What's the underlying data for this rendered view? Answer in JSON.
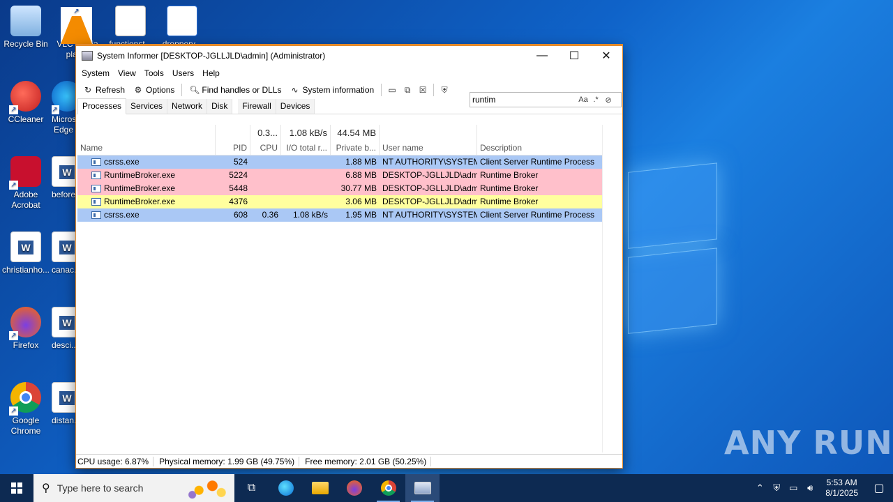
{
  "desktop": {
    "icons": [
      {
        "label": "Recycle Bin"
      },
      {
        "label": "VLC media player"
      },
      {
        "label": "functionst..."
      },
      {
        "label": "dropperv..."
      },
      {
        "label": "CCleaner"
      },
      {
        "label": "Microsoft Edge"
      },
      {
        "label": "Adobe Acrobat"
      },
      {
        "label": "before..."
      },
      {
        "label": "christianho..."
      },
      {
        "label": "canac..."
      },
      {
        "label": "Firefox"
      },
      {
        "label": "desci..."
      },
      {
        "label": "Google Chrome"
      },
      {
        "label": "distan..."
      }
    ],
    "watermark": "ANY RUN"
  },
  "window": {
    "title": "System Informer [DESKTOP-JGLLJLD\\admin] (Administrator)",
    "menu": [
      "System",
      "View",
      "Tools",
      "Users",
      "Help"
    ],
    "toolbar": {
      "refresh": "Refresh",
      "options": "Options",
      "find_handles": "Find handles or DLLs",
      "system_info": "System information"
    },
    "search": {
      "value": "runtim",
      "case_label": "Aa",
      "regex_label": ".*"
    },
    "tabs": [
      "Processes",
      "Services",
      "Network",
      "Disk",
      "Firewall",
      "Devices"
    ],
    "summary": {
      "cpu": "0.3...",
      "io": "1.08 kB/s",
      "private": "44.54 MB"
    },
    "columns": {
      "name": "Name",
      "pid": "PID",
      "cpu": "CPU",
      "io": "I/O total r...",
      "private": "Private b...",
      "user": "User name",
      "description": "Description"
    },
    "rows": [
      {
        "name": "csrss.exe",
        "pid": "524",
        "cpu": "",
        "io": "",
        "private": "1.88 MB",
        "user": "NT AUTHORITY\\SYSTEM",
        "description": "Client Server Runtime Process",
        "kind": "sys"
      },
      {
        "name": "RuntimeBroker.exe",
        "pid": "5224",
        "cpu": "",
        "io": "",
        "private": "6.88 MB",
        "user": "DESKTOP-JGLLJLD\\admi",
        "description": "Runtime Broker",
        "kind": "user"
      },
      {
        "name": "RuntimeBroker.exe",
        "pid": "5448",
        "cpu": "",
        "io": "",
        "private": "30.77 MB",
        "user": "DESKTOP-JGLLJLD\\admi",
        "description": "Runtime Broker",
        "kind": "user"
      },
      {
        "name": "RuntimeBroker.exe",
        "pid": "4376",
        "cpu": "",
        "io": "",
        "private": "3.06 MB",
        "user": "DESKTOP-JGLLJLD\\admi",
        "description": "Runtime Broker",
        "kind": "svc"
      },
      {
        "name": "csrss.exe",
        "pid": "608",
        "cpu": "0.36",
        "io": "1.08 kB/s",
        "private": "1.95 MB",
        "user": "NT AUTHORITY\\SYSTEM",
        "description": "Client Server Runtime Process",
        "kind": "sys"
      }
    ],
    "status": {
      "cpu": "CPU usage: 6.87%",
      "physical": "Physical memory: 1.99 GB (49.75%)",
      "free": "Free memory: 2.01 GB (50.25%)"
    }
  },
  "taskbar": {
    "search_placeholder": "Type here to search",
    "time": "5:53 AM",
    "date": "8/1/2025"
  }
}
